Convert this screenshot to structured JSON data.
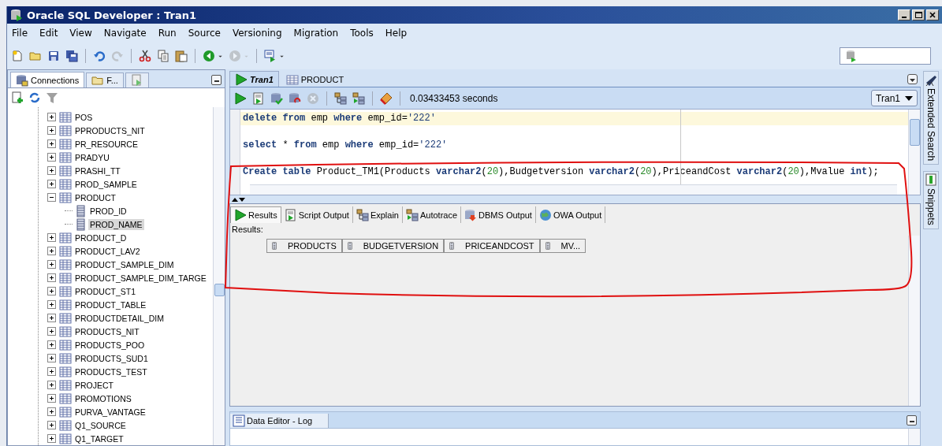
{
  "window": {
    "title": "Oracle SQL Developer : Tran1"
  },
  "menu": [
    "File",
    "Edit",
    "View",
    "Navigate",
    "Run",
    "Source",
    "Versioning",
    "Migration",
    "Tools",
    "Help"
  ],
  "main_toolbar": [
    {
      "kind": "new",
      "disabled": false
    },
    {
      "kind": "open",
      "disabled": false
    },
    {
      "kind": "save",
      "disabled": false
    },
    {
      "kind": "save_all",
      "disabled": false
    },
    {
      "kind": "separator"
    },
    {
      "kind": "undo",
      "disabled": false
    },
    {
      "kind": "redo",
      "disabled": true
    },
    {
      "kind": "separator"
    },
    {
      "kind": "cut",
      "disabled": false
    },
    {
      "kind": "copy",
      "disabled": false
    },
    {
      "kind": "paste",
      "disabled": false
    },
    {
      "kind": "separator"
    },
    {
      "kind": "back",
      "disabled": false
    },
    {
      "kind": "forward",
      "disabled": true
    },
    {
      "kind": "separator"
    },
    {
      "kind": "sql",
      "disabled": false
    }
  ],
  "navigator": {
    "tabs": [
      {
        "label": "Connections",
        "selected": true,
        "kind": "connections"
      },
      {
        "label": "F...",
        "selected": false,
        "kind": "files"
      },
      {
        "selected": false,
        "kind": "reports"
      }
    ],
    "tree": [
      {
        "label": "POS",
        "expanded": false,
        "selected": false
      },
      {
        "label": "PPRODUCTS_NIT",
        "expanded": false,
        "selected": false
      },
      {
        "label": "PR_RESOURCE",
        "expanded": false,
        "selected": false
      },
      {
        "label": "PRADYU",
        "expanded": false,
        "selected": false
      },
      {
        "label": "PRASHI_TT",
        "expanded": false,
        "selected": false
      },
      {
        "label": "PROD_SAMPLE",
        "expanded": false,
        "selected": false
      },
      {
        "label": "PRODUCT",
        "expanded": true,
        "selected": false,
        "children": [
          {
            "label": "PROD_ID",
            "selected": false
          },
          {
            "label": "PROD_NAME",
            "selected": true
          }
        ]
      },
      {
        "label": "PRODUCT_D",
        "expanded": false,
        "selected": false
      },
      {
        "label": "PRODUCT_LAV2",
        "expanded": false,
        "selected": false
      },
      {
        "label": "PRODUCT_SAMPLE_DIM",
        "expanded": false,
        "selected": false
      },
      {
        "label": "PRODUCT_SAMPLE_DIM_TARGE",
        "expanded": false,
        "selected": false
      },
      {
        "label": "PRODUCT_ST1",
        "expanded": false,
        "selected": false
      },
      {
        "label": "PRODUCT_TABLE",
        "expanded": false,
        "selected": false
      },
      {
        "label": "PRODUCTDETAIL_DIM",
        "expanded": false,
        "selected": false
      },
      {
        "label": "PRODUCTS_NIT",
        "expanded": false,
        "selected": false
      },
      {
        "label": "PRODUCTS_POO",
        "expanded": false,
        "selected": false
      },
      {
        "label": "PRODUCTS_SUD1",
        "expanded": false,
        "selected": false
      },
      {
        "label": "PRODUCTS_TEST",
        "expanded": false,
        "selected": false
      },
      {
        "label": "PROJECT",
        "expanded": false,
        "selected": false
      },
      {
        "label": "PROMOTIONS",
        "expanded": false,
        "selected": false
      },
      {
        "label": "PURVA_VANTAGE",
        "expanded": false,
        "selected": false
      },
      {
        "label": "Q1_SOURCE",
        "expanded": false,
        "selected": false
      },
      {
        "label": "Q1_TARGET",
        "expanded": false,
        "selected": false
      }
    ]
  },
  "editor": {
    "tabs": [
      {
        "label": "Tran1",
        "selected": true,
        "kind": "worksheet"
      },
      {
        "label": "PRODUCT",
        "selected": false,
        "kind": "table"
      }
    ],
    "toolbar": [
      {
        "kind": "run",
        "disabled": false
      },
      {
        "kind": "run_script",
        "disabled": false
      },
      {
        "kind": "commit",
        "disabled": false
      },
      {
        "kind": "rollback",
        "disabled": false
      },
      {
        "kind": "cancel",
        "disabled": true
      },
      {
        "kind": "separator"
      },
      {
        "kind": "explain",
        "disabled": false
      },
      {
        "kind": "autotrace",
        "disabled": false
      },
      {
        "kind": "separator"
      },
      {
        "kind": "clear",
        "disabled": false
      },
      {
        "kind": "separator"
      }
    ],
    "elapsed": "0.03433453 seconds",
    "connection": "Tran1",
    "statements": [
      {
        "current": true,
        "tokens": [
          {
            "kind": "keyword",
            "text": "delete"
          },
          {
            "kind": "keyword",
            "text": " from"
          },
          {
            "kind": "plain",
            "text": " emp "
          },
          {
            "kind": "keyword",
            "text": "where"
          },
          {
            "kind": "plain",
            "text": " emp_id="
          },
          {
            "kind": "string",
            "text": "'222'"
          }
        ]
      },
      {
        "current": false,
        "tokens": [
          {
            "kind": "keyword",
            "text": "select"
          },
          {
            "kind": "plain",
            "text": " * "
          },
          {
            "kind": "keyword",
            "text": "from"
          },
          {
            "kind": "plain",
            "text": " emp "
          },
          {
            "kind": "keyword",
            "text": "where"
          },
          {
            "kind": "plain",
            "text": " emp_id="
          },
          {
            "kind": "string",
            "text": "'222'"
          }
        ]
      },
      {
        "current": false,
        "tokens": [
          {
            "kind": "keyword",
            "text": "Create"
          },
          {
            "kind": "keyword",
            "text": " table"
          },
          {
            "kind": "plain",
            "text": " Product_TM1(Products "
          },
          {
            "kind": "keyword",
            "text": "varchar2"
          },
          {
            "kind": "plain",
            "text": "("
          },
          {
            "kind": "number",
            "text": "20"
          },
          {
            "kind": "plain",
            "text": "),Budgetversion "
          },
          {
            "kind": "keyword",
            "text": "varchar2"
          },
          {
            "kind": "plain",
            "text": "("
          },
          {
            "kind": "number",
            "text": "20"
          },
          {
            "kind": "plain",
            "text": "),PriceandCost "
          },
          {
            "kind": "keyword",
            "text": "varchar2"
          },
          {
            "kind": "plain",
            "text": "("
          },
          {
            "kind": "number",
            "text": "20"
          },
          {
            "kind": "plain",
            "text": "),Mvalue "
          },
          {
            "kind": "keyword",
            "text": "int"
          },
          {
            "kind": "plain",
            "text": ");"
          }
        ]
      }
    ]
  },
  "results": {
    "tabs": [
      {
        "label": "Results",
        "selected": true,
        "kind": "results"
      },
      {
        "label": "Script Output",
        "selected": false,
        "kind": "script"
      },
      {
        "label": "Explain",
        "selected": false,
        "kind": "explain"
      },
      {
        "label": "Autotrace",
        "selected": false,
        "kind": "autotrace"
      },
      {
        "label": "DBMS Output",
        "selected": false,
        "kind": "dbms"
      },
      {
        "label": "OWA Output",
        "selected": false,
        "kind": "owa"
      }
    ],
    "caption": "Results:",
    "columns": [
      "PRODUCTS",
      "BUDGETVERSION",
      "PRICEANDCOST",
      "MV..."
    ]
  },
  "log": {
    "tab": "Data Editor - Log"
  },
  "side_tabs": [
    {
      "label": "Extended Search",
      "kind": "search"
    },
    {
      "label": "Snippets",
      "kind": "snippets"
    }
  ]
}
